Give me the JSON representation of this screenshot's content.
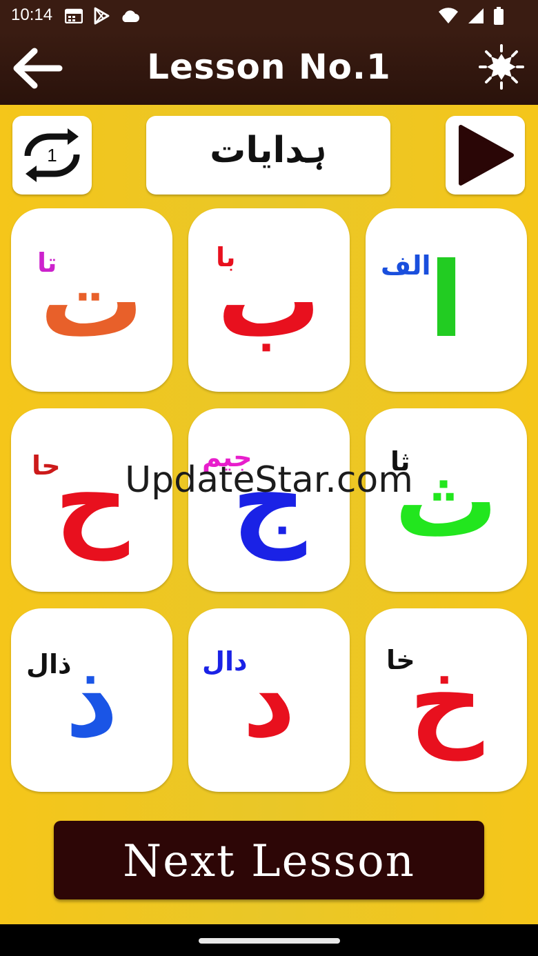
{
  "status_bar": {
    "time": "10:14",
    "icons_left": [
      "calendar-icon",
      "play-store-icon",
      "cloud-icon"
    ],
    "icons_right": [
      "wifi-icon",
      "signal-icon",
      "battery-icon"
    ]
  },
  "app_bar": {
    "title": "Lesson No.1",
    "back_icon": "arrow-left-icon",
    "theme_icon": "brightness-icon"
  },
  "controls": {
    "repeat_count": "1",
    "instructions_label": "ہدایات",
    "play_icon": "play-icon"
  },
  "letters": [
    {
      "letter": "ا",
      "name": "الف",
      "letter_color": "#22cc22",
      "name_color": "#1a4fdd"
    },
    {
      "letter": "ب",
      "name": "با",
      "letter_color": "#e8101e",
      "name_color": "#e8101e"
    },
    {
      "letter": "ت",
      "name": "تا",
      "letter_color": "#e8602a",
      "name_color": "#cc22cc"
    },
    {
      "letter": "ث",
      "name": "ثا",
      "letter_color": "#22e61e",
      "name_color": "#111111"
    },
    {
      "letter": "ج",
      "name": "جیم",
      "letter_color": "#1a22e6",
      "name_color": "#e81ecc"
    },
    {
      "letter": "ح",
      "name": "حا",
      "letter_color": "#e8101e",
      "name_color": "#cc1a1a"
    },
    {
      "letter": "خ",
      "name": "خا",
      "letter_color": "#e8101e",
      "name_color": "#111111"
    },
    {
      "letter": "د",
      "name": "دال",
      "letter_color": "#e8101e",
      "name_color": "#1a22e6"
    },
    {
      "letter": "ذ",
      "name": "ذال",
      "letter_color": "#1a55e6",
      "name_color": "#111111"
    }
  ],
  "next_button": {
    "label": "Next Lesson"
  },
  "watermark": "UpdateStar.com",
  "colors": {
    "app_bar": "#3a1c12",
    "background": "#f0c81e",
    "next_button": "#2d0606"
  }
}
